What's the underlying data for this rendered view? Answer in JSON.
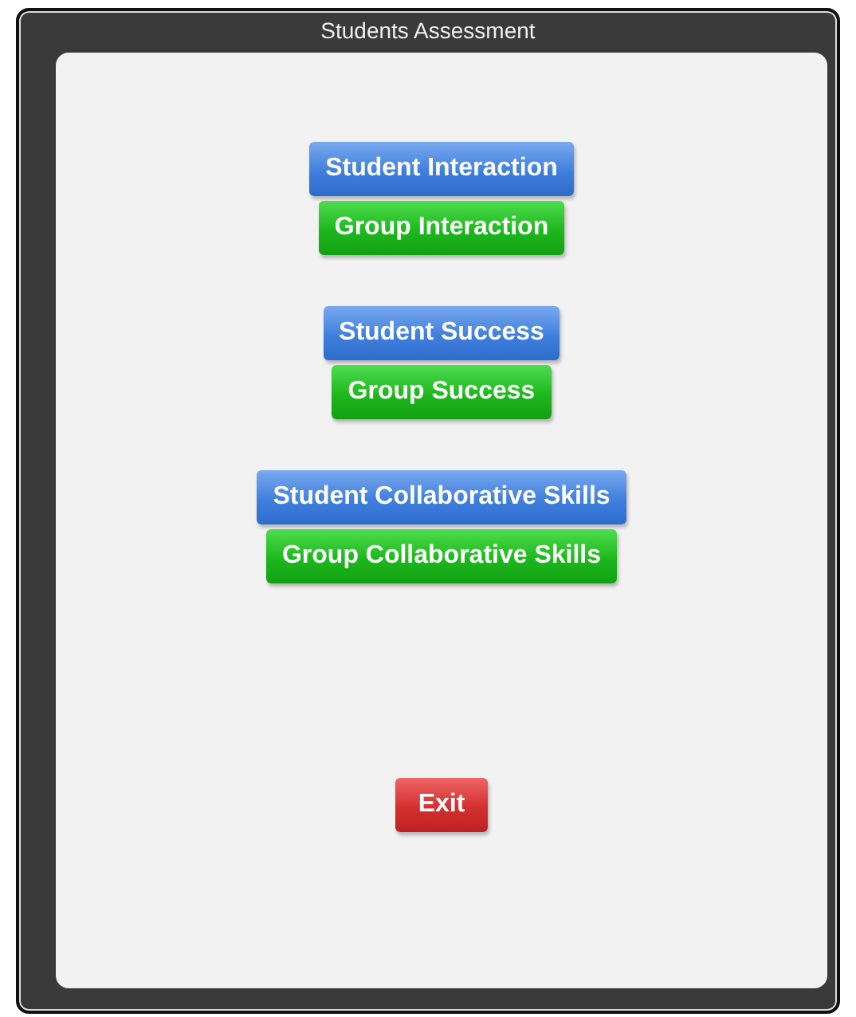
{
  "window": {
    "title": "Students Assessment"
  },
  "button_groups": [
    {
      "buttons": [
        {
          "label": "Student Interaction",
          "kind": "student"
        },
        {
          "label": "Group Interaction",
          "kind": "group"
        }
      ]
    },
    {
      "buttons": [
        {
          "label": "Student Success",
          "kind": "student"
        },
        {
          "label": "Group Success",
          "kind": "group"
        }
      ]
    },
    {
      "buttons": [
        {
          "label": "Student Collaborative Skills",
          "kind": "student"
        },
        {
          "label": "Group Collaborative Skills",
          "kind": "group"
        }
      ]
    }
  ],
  "exit_button": {
    "label": "Exit",
    "kind": "exit"
  }
}
